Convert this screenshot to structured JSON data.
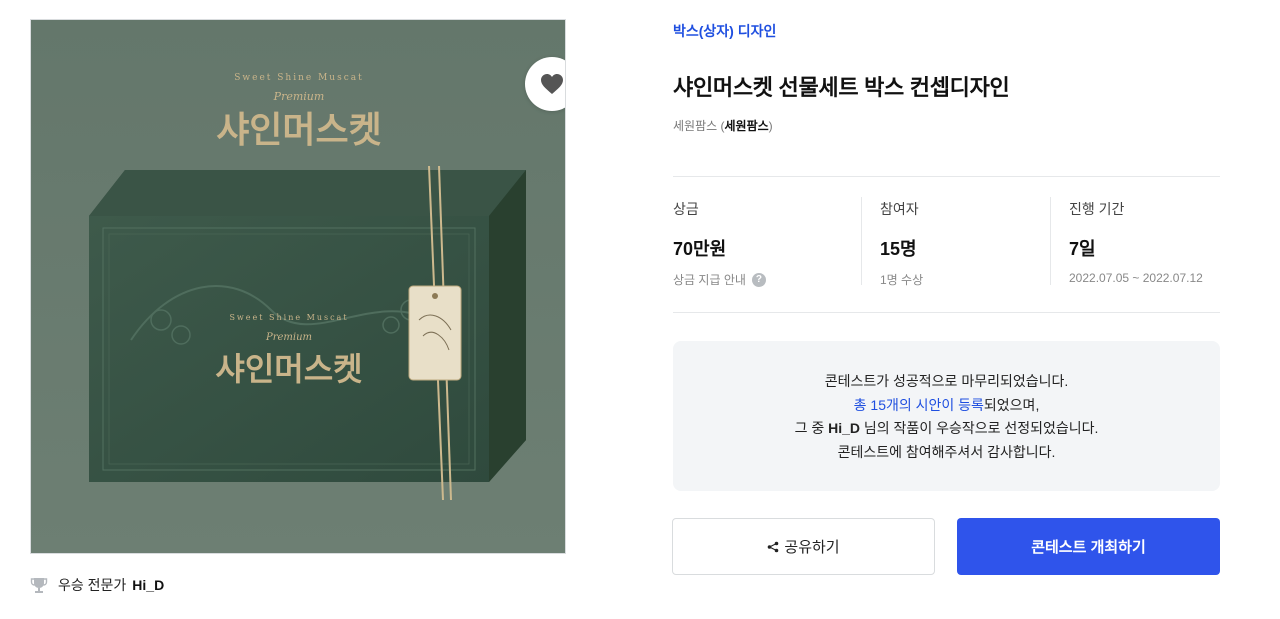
{
  "product": {
    "image_alt": "Shine Muscat gift box",
    "box_brand": "샤인머스켓",
    "box_tagline": "Sweet Shine Muscat",
    "box_premium": "Premium"
  },
  "winner": {
    "label": "우승 전문가",
    "name": "Hi_D"
  },
  "contest": {
    "category": "박스(상자) 디자인",
    "title": "샤인머스켓 선물세트 박스 컨셉디자인",
    "host_prefix": "세원팜스 (",
    "host_name": "세원팜스",
    "host_suffix": ")"
  },
  "stats": [
    {
      "label": "상금",
      "value": "70만원",
      "sub": "상금 지급 안내"
    },
    {
      "label": "참여자",
      "value": "15명",
      "sub": "1명 수상"
    },
    {
      "label": "진행 기간",
      "value": "7일",
      "sub": "2022.07.05 ~ 2022.07.12"
    }
  ],
  "notice": {
    "line1": "콘테스트가 성공적으로 마무리되었습니다.",
    "line2_link": "총 15개의 시안이 등록",
    "line2_rest": "되었으며,",
    "line3_prefix": "그 중 ",
    "line3_name": "Hi_D",
    "line3_rest": " 님의 작품이 우승작으로 선정되었습니다.",
    "line4": "콘테스트에 참여해주셔서 감사합니다."
  },
  "actions": {
    "share_label": "공유하기",
    "host_label": "콘테스트 개최하기"
  },
  "colors": {
    "accent": "#2f54eb",
    "link": "#1f4fe0",
    "box_green": "#3f5a4c",
    "gold": "#c9b48a"
  }
}
